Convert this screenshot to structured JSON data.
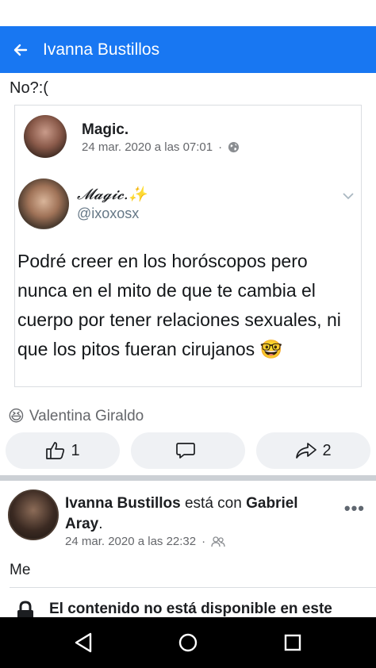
{
  "app_bar": {
    "title": "Ivanna Bustillos",
    "back_icon": "back-arrow-icon",
    "bg_color": "#1877f2"
  },
  "post": {
    "text": "No?:("
  },
  "shared_post": {
    "author": "Magic.",
    "timestamp": "24 mar. 2020 a las 07:01",
    "privacy_icon": "globe-icon",
    "tweet": {
      "display_name": "𝓜𝓪𝓰𝓲𝓬.✨",
      "handle": "@ixoxosx",
      "text": "Podré creer en los horóscopos pero nunca en el mito de que te cambia el cuerpo por tener relaciones sexuales, ni que los pitos fueran cirujanos 🤓"
    }
  },
  "reactions": {
    "emoji": "😆",
    "names": "Valentina Giraldo"
  },
  "actions": {
    "like_count": "1",
    "comment_count": "",
    "share_count": "2"
  },
  "second_post": {
    "author": "Ivanna Bustillos",
    "with_text": " está con ",
    "tagged": "Gabriel Aray",
    "suffix": ".",
    "timestamp": "24 mar. 2020 a las 22:32",
    "audience_icon": "friends-icon",
    "text": "Me",
    "unavailable_notice": "El contenido no está disponible en este"
  },
  "nav": {
    "back": "nav-back-icon",
    "home": "nav-home-icon",
    "recents": "nav-recents-icon"
  }
}
